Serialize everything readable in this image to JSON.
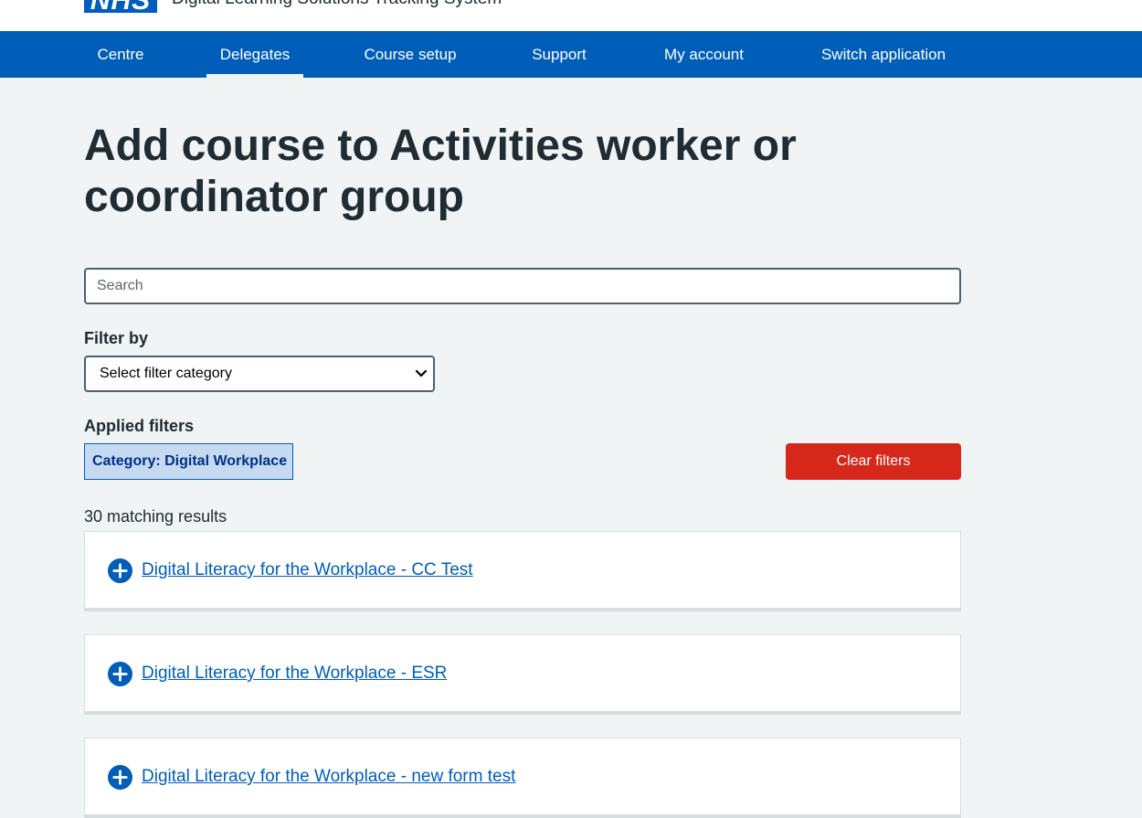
{
  "header": {
    "logo_text": "NHS",
    "service_name": "Digital Learning Solutions Tracking System"
  },
  "nav": {
    "items": [
      {
        "label": "Centre"
      },
      {
        "label": "Delegates",
        "active": true
      },
      {
        "label": "Course setup"
      },
      {
        "label": "Support"
      },
      {
        "label": "My account"
      },
      {
        "label": "Switch application"
      }
    ]
  },
  "page": {
    "title": "Add course to Activities worker or coordinator group"
  },
  "search": {
    "placeholder": "Search",
    "value": ""
  },
  "filter": {
    "label": "Filter by",
    "selected": "Select filter category",
    "icon": "chevron-down-icon"
  },
  "applied_filters": {
    "label": "Applied filters",
    "tags": [
      {
        "label": "Category: Digital Workplace"
      }
    ],
    "clear_label": "Clear filters"
  },
  "results": {
    "count_text": "30 matching results",
    "items": [
      {
        "title": "Digital Literacy for the Workplace - CC Test",
        "icon": "plus-circle-icon"
      },
      {
        "title": "Digital Literacy for the Workplace - ESR",
        "icon": "plus-circle-icon"
      },
      {
        "title": "Digital Literacy for the Workplace - new form test",
        "icon": "plus-circle-icon"
      }
    ]
  },
  "colors": {
    "brand_blue": "#005eb8",
    "background": "#f0f4f5",
    "danger_red": "#d5281b",
    "tag_background": "#c5daf0",
    "text": "#212b32"
  }
}
